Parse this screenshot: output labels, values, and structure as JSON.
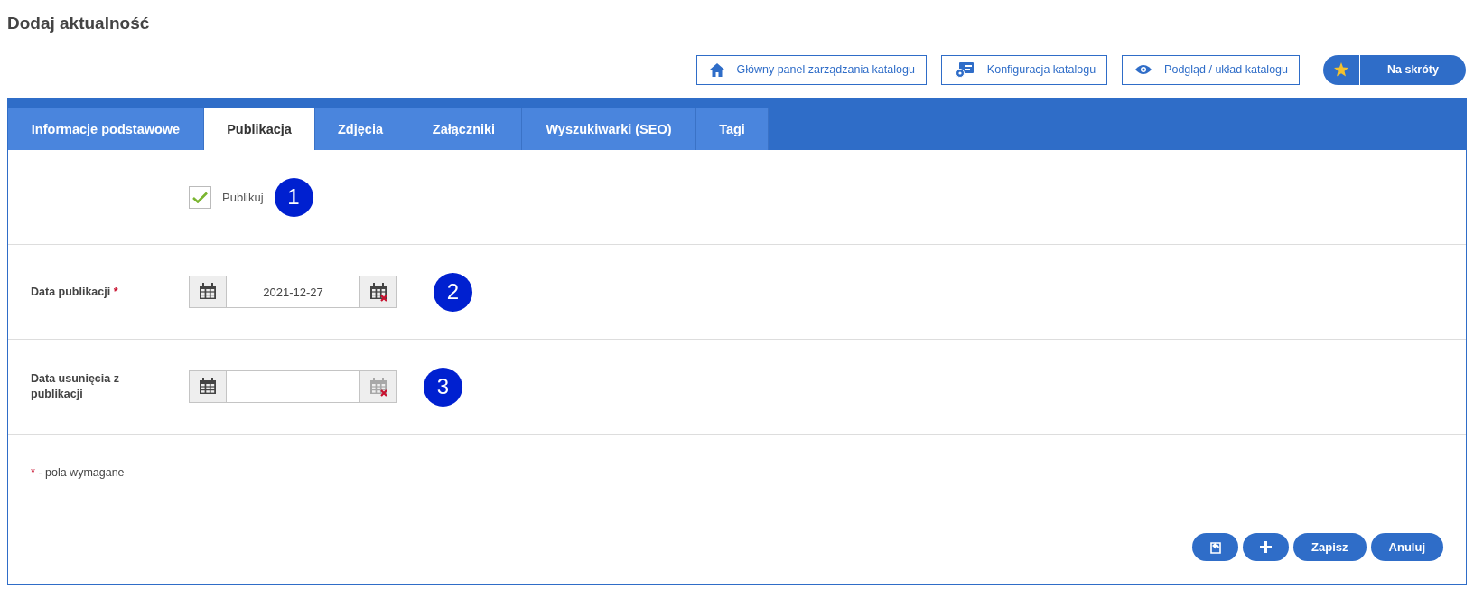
{
  "page_title": "Dodaj aktualność",
  "toolbar": [
    {
      "label": "Główny panel zarządzania katalogu"
    },
    {
      "label": "Konfiguracja katalogu"
    },
    {
      "label": "Podgląd / układ katalogu"
    }
  ],
  "shortcuts_button": {
    "label": "Na skróty"
  },
  "tabs": [
    {
      "label": "Informacje podstawowe",
      "selected": false
    },
    {
      "label": "Publikacja",
      "selected": true
    },
    {
      "label": "Zdjęcia",
      "selected": false
    },
    {
      "label": "Załączniki",
      "selected": false
    },
    {
      "label": "Wyszukiwarki (SEO)",
      "selected": false
    },
    {
      "label": "Tagi",
      "selected": false
    }
  ],
  "rows": [
    {
      "kind": "checkbox",
      "label": "Publikuj",
      "checked": true,
      "marker": "1"
    },
    {
      "kind": "date",
      "label": "Data publikacji",
      "required": true,
      "value": "2021-12-27",
      "clear_disabled": false,
      "marker": "2"
    },
    {
      "kind": "date",
      "label": "Data usunięcia z publikacji",
      "required": false,
      "value": "",
      "clear_disabled": true,
      "marker": "3"
    }
  ],
  "required_note": {
    "mark": "*",
    "text": "- pola wymagane"
  },
  "footer_buttons": [
    {
      "kind": "icon"
    },
    {
      "kind": "icon"
    },
    {
      "kind": "text",
      "label": "Zapisz"
    },
    {
      "kind": "text",
      "label": "Anuluj"
    }
  ]
}
